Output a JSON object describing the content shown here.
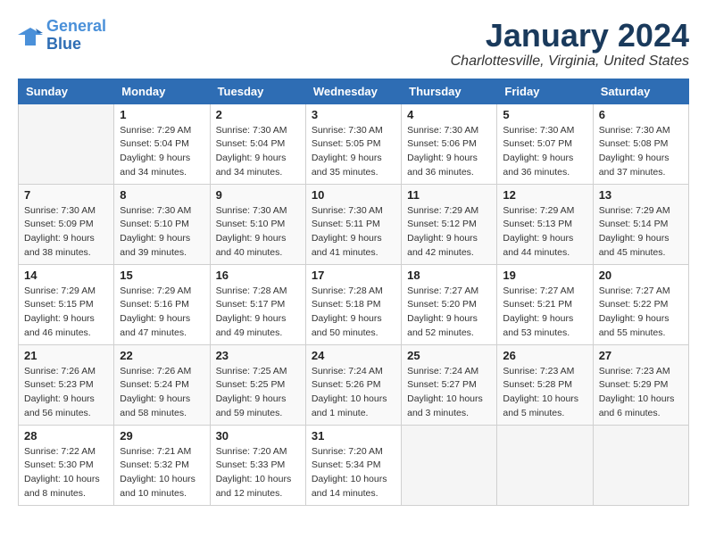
{
  "header": {
    "logo_line1": "General",
    "logo_line2": "Blue",
    "month": "January 2024",
    "location": "Charlottesville, Virginia, United States"
  },
  "weekdays": [
    "Sunday",
    "Monday",
    "Tuesday",
    "Wednesday",
    "Thursday",
    "Friday",
    "Saturday"
  ],
  "weeks": [
    [
      {
        "day": "",
        "sunrise": "",
        "sunset": "",
        "daylight": ""
      },
      {
        "day": "1",
        "sunrise": "Sunrise: 7:29 AM",
        "sunset": "Sunset: 5:04 PM",
        "daylight": "Daylight: 9 hours and 34 minutes."
      },
      {
        "day": "2",
        "sunrise": "Sunrise: 7:30 AM",
        "sunset": "Sunset: 5:04 PM",
        "daylight": "Daylight: 9 hours and 34 minutes."
      },
      {
        "day": "3",
        "sunrise": "Sunrise: 7:30 AM",
        "sunset": "Sunset: 5:05 PM",
        "daylight": "Daylight: 9 hours and 35 minutes."
      },
      {
        "day": "4",
        "sunrise": "Sunrise: 7:30 AM",
        "sunset": "Sunset: 5:06 PM",
        "daylight": "Daylight: 9 hours and 36 minutes."
      },
      {
        "day": "5",
        "sunrise": "Sunrise: 7:30 AM",
        "sunset": "Sunset: 5:07 PM",
        "daylight": "Daylight: 9 hours and 36 minutes."
      },
      {
        "day": "6",
        "sunrise": "Sunrise: 7:30 AM",
        "sunset": "Sunset: 5:08 PM",
        "daylight": "Daylight: 9 hours and 37 minutes."
      }
    ],
    [
      {
        "day": "7",
        "sunrise": "Sunrise: 7:30 AM",
        "sunset": "Sunset: 5:09 PM",
        "daylight": "Daylight: 9 hours and 38 minutes."
      },
      {
        "day": "8",
        "sunrise": "Sunrise: 7:30 AM",
        "sunset": "Sunset: 5:10 PM",
        "daylight": "Daylight: 9 hours and 39 minutes."
      },
      {
        "day": "9",
        "sunrise": "Sunrise: 7:30 AM",
        "sunset": "Sunset: 5:10 PM",
        "daylight": "Daylight: 9 hours and 40 minutes."
      },
      {
        "day": "10",
        "sunrise": "Sunrise: 7:30 AM",
        "sunset": "Sunset: 5:11 PM",
        "daylight": "Daylight: 9 hours and 41 minutes."
      },
      {
        "day": "11",
        "sunrise": "Sunrise: 7:29 AM",
        "sunset": "Sunset: 5:12 PM",
        "daylight": "Daylight: 9 hours and 42 minutes."
      },
      {
        "day": "12",
        "sunrise": "Sunrise: 7:29 AM",
        "sunset": "Sunset: 5:13 PM",
        "daylight": "Daylight: 9 hours and 44 minutes."
      },
      {
        "day": "13",
        "sunrise": "Sunrise: 7:29 AM",
        "sunset": "Sunset: 5:14 PM",
        "daylight": "Daylight: 9 hours and 45 minutes."
      }
    ],
    [
      {
        "day": "14",
        "sunrise": "Sunrise: 7:29 AM",
        "sunset": "Sunset: 5:15 PM",
        "daylight": "Daylight: 9 hours and 46 minutes."
      },
      {
        "day": "15",
        "sunrise": "Sunrise: 7:29 AM",
        "sunset": "Sunset: 5:16 PM",
        "daylight": "Daylight: 9 hours and 47 minutes."
      },
      {
        "day": "16",
        "sunrise": "Sunrise: 7:28 AM",
        "sunset": "Sunset: 5:17 PM",
        "daylight": "Daylight: 9 hours and 49 minutes."
      },
      {
        "day": "17",
        "sunrise": "Sunrise: 7:28 AM",
        "sunset": "Sunset: 5:18 PM",
        "daylight": "Daylight: 9 hours and 50 minutes."
      },
      {
        "day": "18",
        "sunrise": "Sunrise: 7:27 AM",
        "sunset": "Sunset: 5:20 PM",
        "daylight": "Daylight: 9 hours and 52 minutes."
      },
      {
        "day": "19",
        "sunrise": "Sunrise: 7:27 AM",
        "sunset": "Sunset: 5:21 PM",
        "daylight": "Daylight: 9 hours and 53 minutes."
      },
      {
        "day": "20",
        "sunrise": "Sunrise: 7:27 AM",
        "sunset": "Sunset: 5:22 PM",
        "daylight": "Daylight: 9 hours and 55 minutes."
      }
    ],
    [
      {
        "day": "21",
        "sunrise": "Sunrise: 7:26 AM",
        "sunset": "Sunset: 5:23 PM",
        "daylight": "Daylight: 9 hours and 56 minutes."
      },
      {
        "day": "22",
        "sunrise": "Sunrise: 7:26 AM",
        "sunset": "Sunset: 5:24 PM",
        "daylight": "Daylight: 9 hours and 58 minutes."
      },
      {
        "day": "23",
        "sunrise": "Sunrise: 7:25 AM",
        "sunset": "Sunset: 5:25 PM",
        "daylight": "Daylight: 9 hours and 59 minutes."
      },
      {
        "day": "24",
        "sunrise": "Sunrise: 7:24 AM",
        "sunset": "Sunset: 5:26 PM",
        "daylight": "Daylight: 10 hours and 1 minute."
      },
      {
        "day": "25",
        "sunrise": "Sunrise: 7:24 AM",
        "sunset": "Sunset: 5:27 PM",
        "daylight": "Daylight: 10 hours and 3 minutes."
      },
      {
        "day": "26",
        "sunrise": "Sunrise: 7:23 AM",
        "sunset": "Sunset: 5:28 PM",
        "daylight": "Daylight: 10 hours and 5 minutes."
      },
      {
        "day": "27",
        "sunrise": "Sunrise: 7:23 AM",
        "sunset": "Sunset: 5:29 PM",
        "daylight": "Daylight: 10 hours and 6 minutes."
      }
    ],
    [
      {
        "day": "28",
        "sunrise": "Sunrise: 7:22 AM",
        "sunset": "Sunset: 5:30 PM",
        "daylight": "Daylight: 10 hours and 8 minutes."
      },
      {
        "day": "29",
        "sunrise": "Sunrise: 7:21 AM",
        "sunset": "Sunset: 5:32 PM",
        "daylight": "Daylight: 10 hours and 10 minutes."
      },
      {
        "day": "30",
        "sunrise": "Sunrise: 7:20 AM",
        "sunset": "Sunset: 5:33 PM",
        "daylight": "Daylight: 10 hours and 12 minutes."
      },
      {
        "day": "31",
        "sunrise": "Sunrise: 7:20 AM",
        "sunset": "Sunset: 5:34 PM",
        "daylight": "Daylight: 10 hours and 14 minutes."
      },
      {
        "day": "",
        "sunrise": "",
        "sunset": "",
        "daylight": ""
      },
      {
        "day": "",
        "sunrise": "",
        "sunset": "",
        "daylight": ""
      },
      {
        "day": "",
        "sunrise": "",
        "sunset": "",
        "daylight": ""
      }
    ]
  ]
}
